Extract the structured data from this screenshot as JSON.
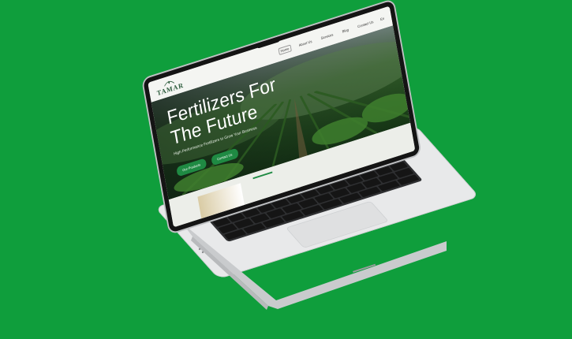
{
  "colors": {
    "background": "#0f9e3c",
    "accent": "#1f8a43",
    "laptop_silver": "#e8e9ea"
  },
  "website": {
    "logo": {
      "text": "TAMAR",
      "icon": "leaf-swirl-icon"
    },
    "nav": {
      "items": [
        "Home",
        "About Us",
        "Services",
        "Blog",
        "Contact Us"
      ],
      "active": "Home",
      "language": "En"
    },
    "hero": {
      "title_line1": "Fertilizers For",
      "title_line2": "The Future",
      "subtitle": "High Performance Fertilizers to Grow Your Business",
      "buttons": [
        "Our Products",
        "Contact Us"
      ]
    }
  }
}
